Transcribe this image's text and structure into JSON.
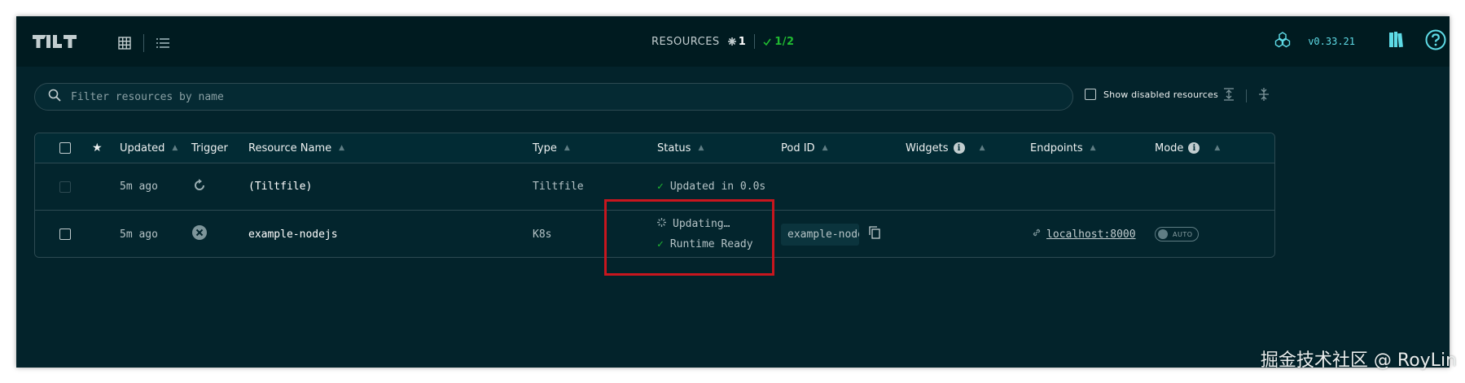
{
  "header": {
    "logo_text": "TILT",
    "view_options": [
      "grid-view-icon",
      "list-view-icon"
    ],
    "resources_label": "RESOURCES",
    "resources_count": "1",
    "ok_count": "1/2",
    "version": "v0.33.21"
  },
  "filter": {
    "placeholder": "Filter resources by name",
    "value": "",
    "show_disabled_label": "Show disabled resources",
    "show_disabled_checked": false
  },
  "table": {
    "columns": {
      "updated": "Updated",
      "trigger": "Trigger",
      "name": "Resource Name",
      "type": "Type",
      "status": "Status",
      "pod_id": "Pod ID",
      "widgets": "Widgets",
      "endpoints": "Endpoints",
      "mode": "Mode"
    },
    "rows": [
      {
        "updated": "5m ago",
        "name": "(Tiltfile)",
        "type": "Tiltfile",
        "status_update": "Updated in 0.0s"
      },
      {
        "updated": "5m ago",
        "name": "example-nodejs",
        "type": "K8s",
        "status_update": "Updating…",
        "status_runtime": "Runtime Ready",
        "pod_id": "example-nodejs",
        "endpoint": "localhost:8000",
        "mode": "AUTO"
      }
    ]
  },
  "watermark": "掘金技术社区 @ RoyLin",
  "colors": {
    "background": "#03232b",
    "header": "#001b20",
    "ok_green": "#20ba31",
    "version_cyan": "#5edbe6",
    "highlight_red": "#c8161e"
  }
}
